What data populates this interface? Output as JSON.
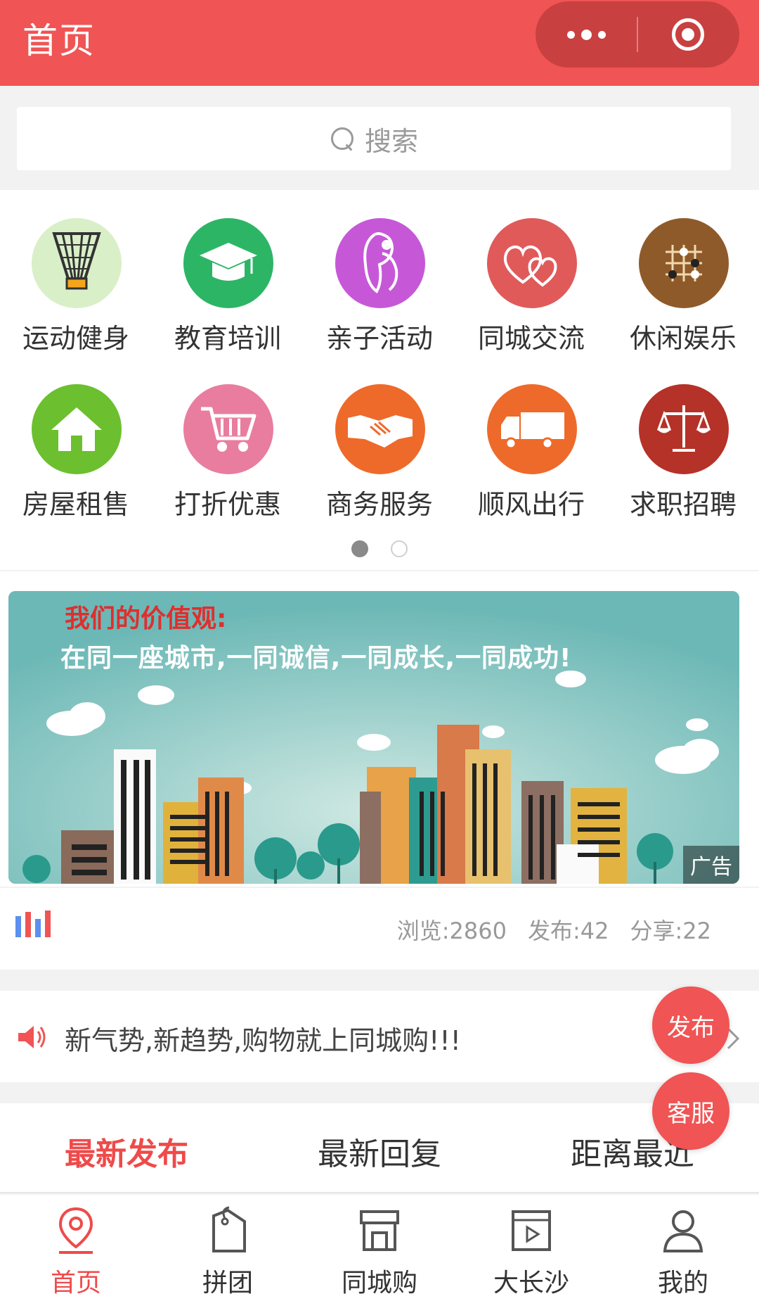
{
  "header": {
    "title": "首页"
  },
  "search": {
    "placeholder": "搜索"
  },
  "categories": [
    {
      "label": "运动健身",
      "icon": "badminton-icon",
      "color": "#d9efc8"
    },
    {
      "label": "教育培训",
      "icon": "graduation-cap-icon",
      "color": "#2db566"
    },
    {
      "label": "亲子活动",
      "icon": "parent-child-icon",
      "color": "#c658d8"
    },
    {
      "label": "同城交流",
      "icon": "hearts-icon",
      "color": "#e05a5a"
    },
    {
      "label": "休闲娱乐",
      "icon": "go-board-icon",
      "color": "#8f5a2a"
    },
    {
      "label": "房屋租售",
      "icon": "house-icon",
      "color": "#6cbf2e"
    },
    {
      "label": "打折优惠",
      "icon": "shopping-cart-icon",
      "color": "#e87da0"
    },
    {
      "label": "商务服务",
      "icon": "handshake-icon",
      "color": "#ee6a2a"
    },
    {
      "label": "顺风出行",
      "icon": "truck-icon",
      "color": "#ee6a2a"
    },
    {
      "label": "求职招聘",
      "icon": "scales-icon",
      "color": "#b53228"
    }
  ],
  "banner": {
    "heading": "我们的价值观:",
    "slogan": "在同一座城市,一同诚信,一同成长,一同成功!",
    "ad_tag": "广告"
  },
  "stats": {
    "views": "浏览:2860",
    "posts": "发布:42",
    "shares": "分享:22"
  },
  "notice": {
    "text": "新气势,新趋势,购物就上同城购!!!"
  },
  "fab": {
    "publish": "发布",
    "service": "客服"
  },
  "tabs": [
    {
      "label": "最新发布",
      "active": true
    },
    {
      "label": "最新回复",
      "active": false
    },
    {
      "label": "距离最近",
      "active": false
    }
  ],
  "nav": [
    {
      "label": "首页",
      "icon": "location-pin-icon",
      "active": true
    },
    {
      "label": "拼团",
      "icon": "tag-icon",
      "active": false
    },
    {
      "label": "同城购",
      "icon": "store-icon",
      "active": false
    },
    {
      "label": "大长沙",
      "icon": "video-icon",
      "active": false
    },
    {
      "label": "我的",
      "icon": "user-icon",
      "active": false
    }
  ],
  "colors": {
    "brand": "#f05454",
    "active_text": "#ef4a4a"
  }
}
